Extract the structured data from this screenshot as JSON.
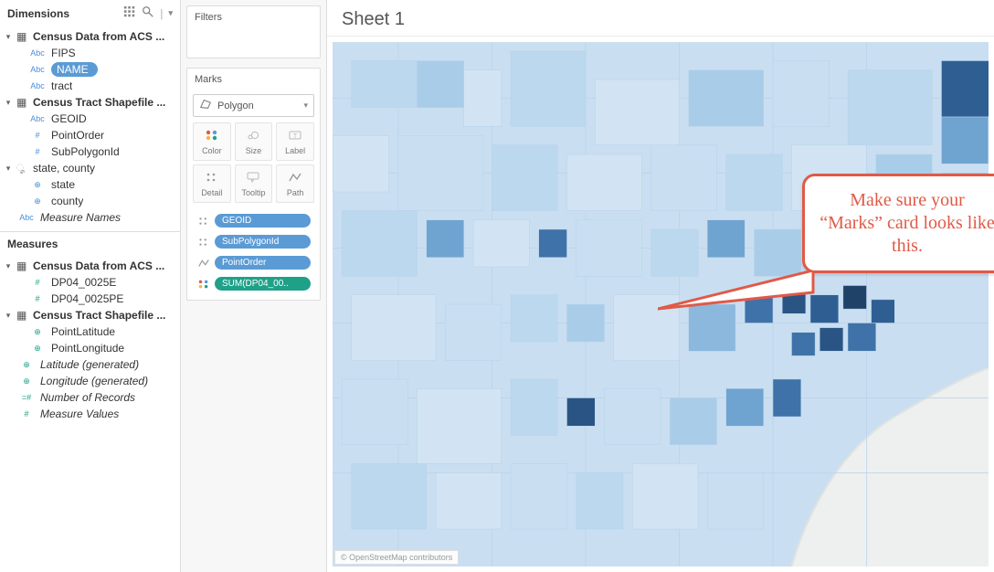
{
  "dimensions": {
    "title": "Dimensions",
    "groups": [
      {
        "label": "Census Data from ACS ...",
        "type": "table"
      },
      {
        "label": "Census Tract Shapefile ...",
        "type": "table"
      },
      {
        "label": "state, county",
        "type": "group"
      }
    ],
    "items": {
      "g0": [
        {
          "type": "Abc",
          "label": "FIPS",
          "selected": false
        },
        {
          "type": "Abc",
          "label": "NAME",
          "selected": true
        },
        {
          "type": "Abc",
          "label": "tract",
          "selected": false
        }
      ],
      "g1": [
        {
          "type": "Abc",
          "label": "GEOID"
        },
        {
          "type": "hash",
          "label": "PointOrder"
        },
        {
          "type": "hash",
          "label": "SubPolygonId"
        }
      ],
      "g2": [
        {
          "type": "globe",
          "label": "state"
        },
        {
          "type": "globe",
          "label": "county"
        }
      ]
    },
    "trailing": [
      {
        "type": "Abc",
        "label": "Measure Names",
        "italic": true
      }
    ]
  },
  "measures": {
    "title": "Measures",
    "groups": [
      {
        "label": "Census Data from ACS ..."
      },
      {
        "label": "Census Tract Shapefile ..."
      }
    ],
    "items": {
      "g0": [
        {
          "type": "hash",
          "label": "DP04_0025E"
        },
        {
          "type": "hash",
          "label": "DP04_0025PE"
        }
      ],
      "g1": [
        {
          "type": "globe",
          "label": "PointLatitude"
        },
        {
          "type": "globe",
          "label": "PointLongitude"
        }
      ]
    },
    "trailing": [
      {
        "type": "globe",
        "label": "Latitude (generated)",
        "italic": true,
        "teal": true
      },
      {
        "type": "globe",
        "label": "Longitude (generated)",
        "italic": true,
        "teal": true
      },
      {
        "type": "dhash",
        "label": "Number of Records",
        "italic": true,
        "teal": true
      },
      {
        "type": "hash",
        "label": "Measure Values",
        "italic": true,
        "teal": true
      }
    ]
  },
  "shelves": {
    "filters": "Filters",
    "marks": "Marks",
    "mark_type": "Polygon",
    "cells": [
      "Color",
      "Size",
      "Label",
      "Detail",
      "Tooltip",
      "Path"
    ],
    "pills": [
      {
        "icon": "detail",
        "label": "GEOID",
        "color": "blue"
      },
      {
        "icon": "detail",
        "label": "SubPolygonId",
        "color": "blue"
      },
      {
        "icon": "path",
        "label": "PointOrder",
        "color": "blue"
      },
      {
        "icon": "color",
        "label": "SUM(DP04_00..",
        "color": "green"
      }
    ]
  },
  "viz": {
    "title": "Sheet 1",
    "attribution": "© OpenStreetMap contributors"
  },
  "callout": {
    "text": "Make sure your “Marks” card looks like this."
  }
}
